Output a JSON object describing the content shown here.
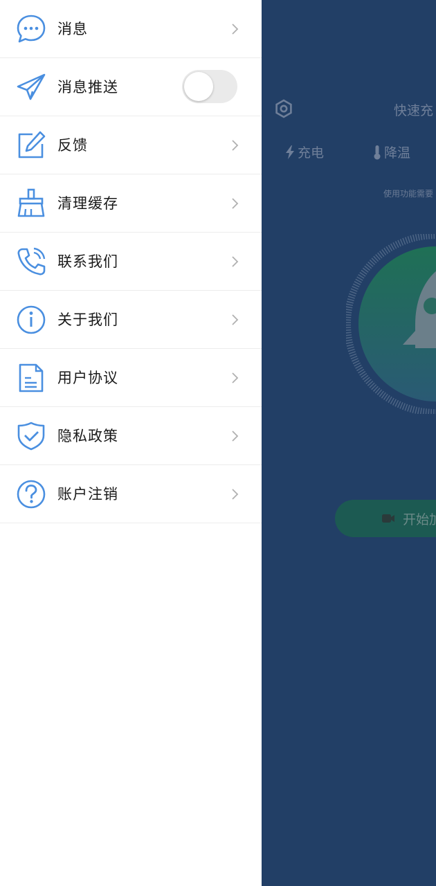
{
  "background": {
    "title": "快速充",
    "tabs": [
      {
        "label": "充电",
        "icon": "lightning-icon"
      },
      {
        "label": "降温",
        "icon": "thermometer-icon"
      }
    ],
    "tip": "使用功能需要",
    "start_button_label": "开始加",
    "colors": {
      "page": "#223f66",
      "gauge": "#1f6b55",
      "button": "#1c5a52"
    }
  },
  "drawer": {
    "items": [
      {
        "label": "消息",
        "icon": "message-bubble-icon",
        "control": "chevron"
      },
      {
        "label": "消息推送",
        "icon": "paper-plane-icon",
        "control": "toggle",
        "toggle_on": false
      },
      {
        "label": "反馈",
        "icon": "edit-icon",
        "control": "chevron"
      },
      {
        "label": "清理缓存",
        "icon": "broom-icon",
        "control": "chevron"
      },
      {
        "label": "联系我们",
        "icon": "phone-icon",
        "control": "chevron"
      },
      {
        "label": "关于我们",
        "icon": "info-icon",
        "control": "chevron"
      },
      {
        "label": "用户协议",
        "icon": "document-icon",
        "control": "chevron"
      },
      {
        "label": "隐私政策",
        "icon": "shield-check-icon",
        "control": "chevron"
      },
      {
        "label": "账户注销",
        "icon": "question-icon",
        "control": "chevron"
      }
    ],
    "colors": {
      "icon": "#4a8fe0",
      "label": "#1a1a1a",
      "chevron": "#b0b0b0",
      "toggle_track": "#eaeaea"
    }
  }
}
